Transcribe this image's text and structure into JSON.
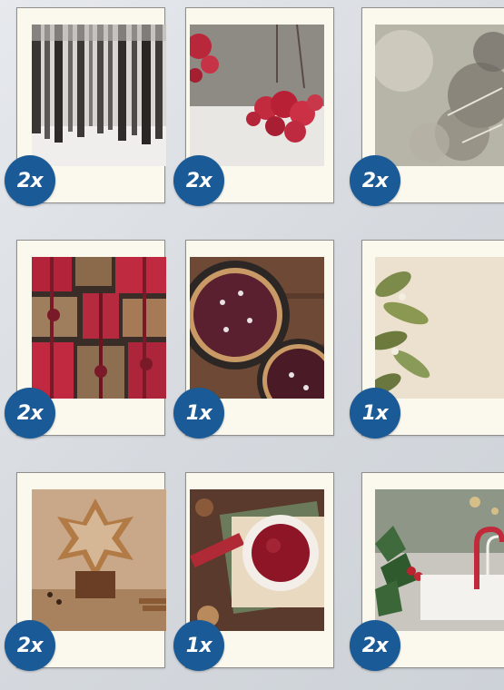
{
  "badges": {
    "b1": "2x",
    "b2": "2x",
    "b3": "2x",
    "b4": "2x",
    "b5": "1x",
    "b6": "1x",
    "b7": "2x",
    "b8": "1x",
    "b9": "2x"
  },
  "colors": {
    "badge": "#1a5a96",
    "card": "#fbf8ee"
  }
}
